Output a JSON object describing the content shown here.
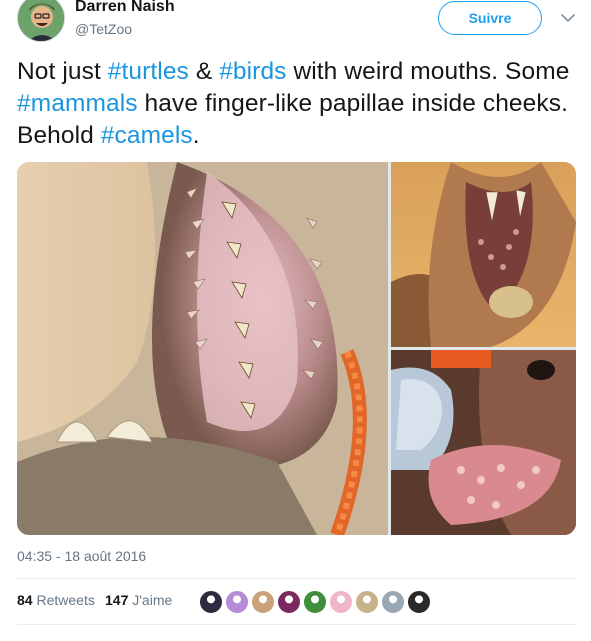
{
  "author": {
    "name": "Darren Naish",
    "handle": "@TetZoo",
    "avatar_icon": "avatar-caricature"
  },
  "follow_label": "Suivre",
  "caret_icon": "chevron-down-icon",
  "tweet": {
    "parts": [
      {
        "text": "Not just ",
        "hashtag": false
      },
      {
        "text": "#turtles",
        "hashtag": true
      },
      {
        "text": " & ",
        "hashtag": false
      },
      {
        "text": "#birds",
        "hashtag": true
      },
      {
        "text": " with weird mouths. Some ",
        "hashtag": false
      },
      {
        "text": "#mammals",
        "hashtag": true
      },
      {
        "text": " have finger-like papillae inside cheeks. Behold ",
        "hashtag": false
      },
      {
        "text": "#camels",
        "hashtag": true
      },
      {
        "text": ".",
        "hashtag": false
      }
    ]
  },
  "media": {
    "photos": [
      "camel-mouth-papillae-closeup",
      "camel-open-mouth",
      "gloved-hand-camel-cheek-papillae"
    ]
  },
  "timestamp": "04:35 - 18 août 2016",
  "stats": {
    "retweets_count": "84",
    "retweets_label": "Retweets",
    "likes_count": "147",
    "likes_label": "J'aime"
  },
  "likers": [
    "#2c2c3e",
    "#b48bd6",
    "#c9a27a",
    "#7a2a5e",
    "#3e8e3a",
    "#f0b6c8",
    "#c8b28a",
    "#9aa8b4",
    "#2a2a2a"
  ],
  "colors": {
    "accent": "#1da1f2",
    "hashtag": "#1b95e0",
    "muted": "#657786"
  }
}
